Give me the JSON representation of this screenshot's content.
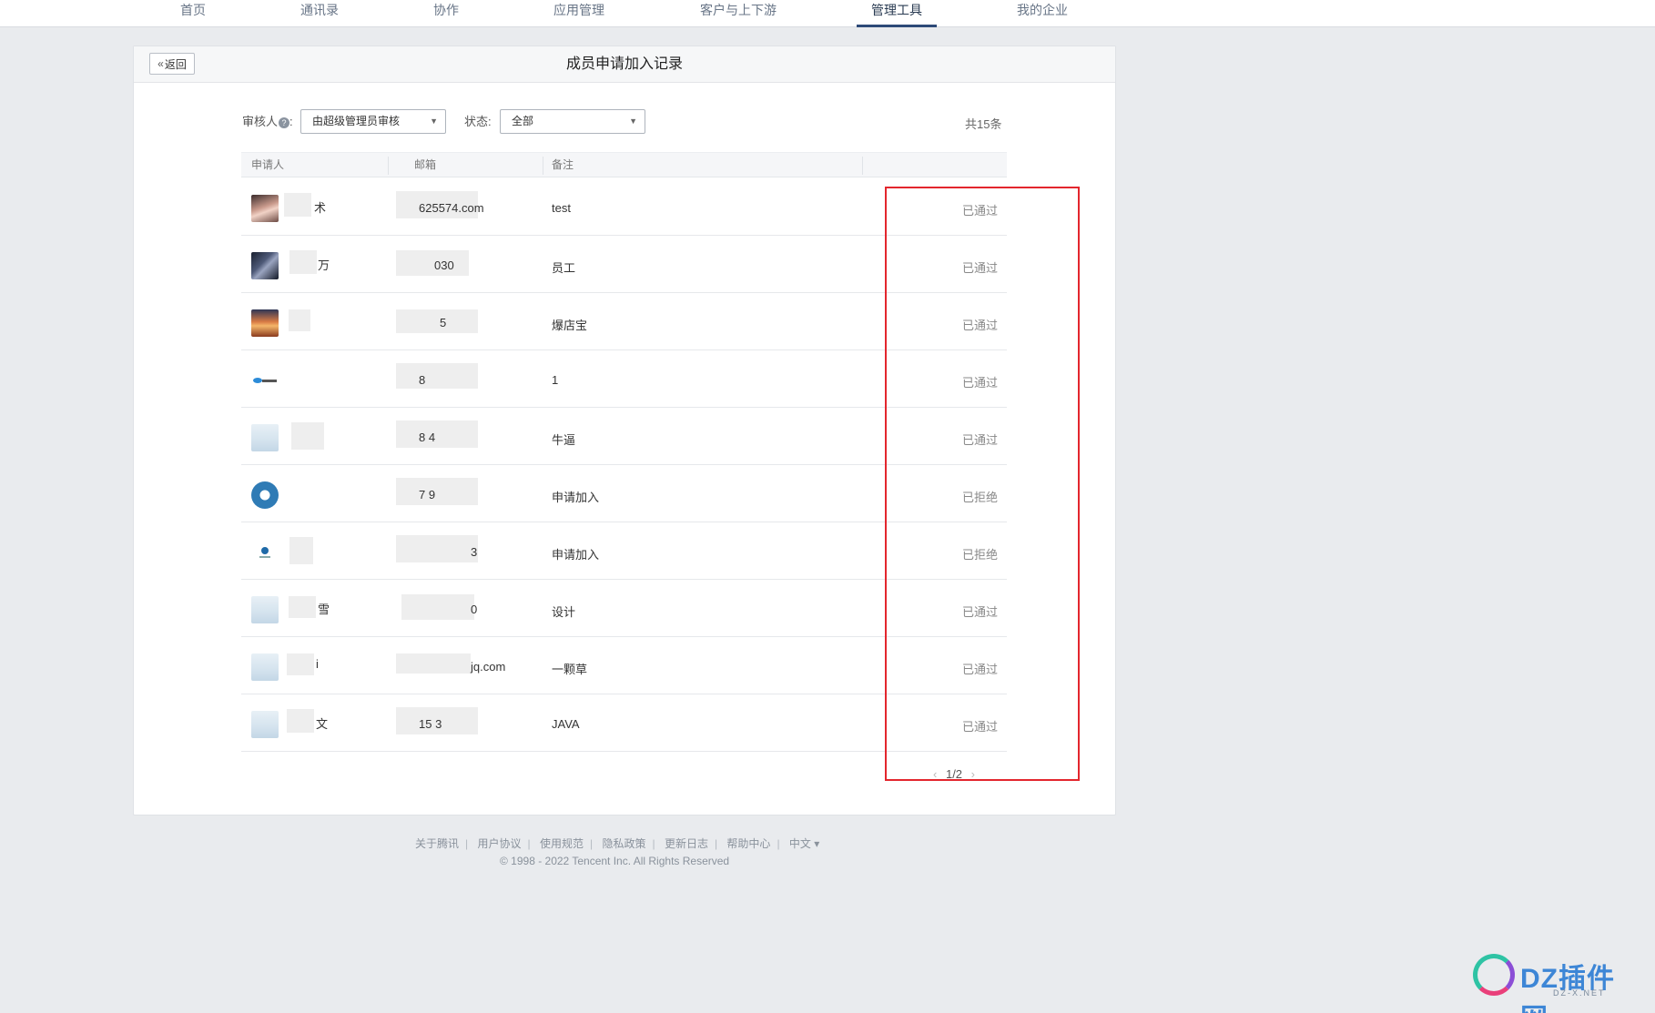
{
  "nav": {
    "items": [
      "首页",
      "通讯录",
      "协作",
      "应用管理",
      "客户与上下游",
      "管理工具",
      "我的企业"
    ],
    "active": "管理工具"
  },
  "card": {
    "back_label": "返回",
    "title": "成员申请加入记录"
  },
  "filters": {
    "reviewer_label": "审核人",
    "reviewer_value": "由超级管理员审核",
    "status_label": "状态:",
    "status_value": "全部",
    "total": "共15条"
  },
  "table": {
    "headers": [
      "申请人",
      "邮箱",
      "备注",
      ""
    ],
    "rows": [
      {
        "name": "术",
        "email": "625574.com",
        "note": "test",
        "status": "已通过",
        "avatar": "girl-photo"
      },
      {
        "name": "万",
        "email": "030",
        "note": "员工",
        "status": "已通过",
        "avatar": "dark-photo"
      },
      {
        "name": "",
        "email": "5",
        "note": "爆店宝",
        "status": "已通过",
        "avatar": "sunset-photo"
      },
      {
        "name": "",
        "email": "8",
        "note": "1",
        "status": "已通过",
        "avatar": "tencent-cloud-logo"
      },
      {
        "name": "",
        "email": "8  4",
        "note": "牛逼",
        "status": "已通过",
        "avatar": "placeholder-image"
      },
      {
        "name": "",
        "email": "7  9",
        "note": "申请加入",
        "status": "已拒绝",
        "avatar": "blue-circle-logo"
      },
      {
        "name": "",
        "email": "3",
        "note": "申请加入",
        "status": "已拒绝",
        "avatar": "small-logo"
      },
      {
        "name": "雪",
        "email": "0",
        "note": "设计",
        "status": "已通过",
        "avatar": "placeholder-image"
      },
      {
        "name": "i",
        "email": "jq.com",
        "note": "一颗草",
        "status": "已通过",
        "avatar": "placeholder-image"
      },
      {
        "name": "文",
        "email": "15  3",
        "note": "JAVA",
        "status": "已通过",
        "avatar": "placeholder-image"
      }
    ]
  },
  "pager": {
    "text": "1/2"
  },
  "footer": {
    "links": [
      "关于腾讯",
      "用户协议",
      "使用规范",
      "隐私政策",
      "更新日志",
      "帮助中心",
      "中文 ▾"
    ],
    "copyright": "© 1998 - 2022 Tencent Inc. All Rights Reserved"
  },
  "watermark": {
    "text": "DZ插件网",
    "sub": "DZ-X.NET"
  },
  "colors": {
    "highlight": "#e3262d",
    "nav_active": "#2d4a78"
  }
}
